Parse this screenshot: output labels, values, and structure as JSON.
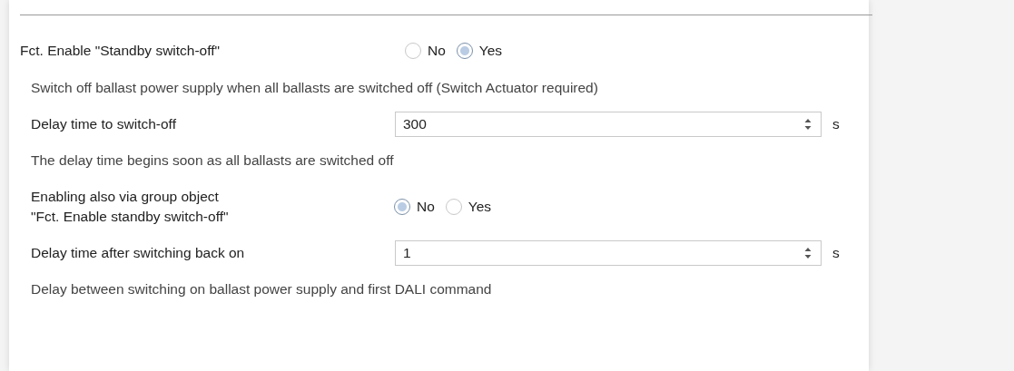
{
  "rows": [
    {
      "kind": "radio",
      "label": "Fct. Enable \"Standby switch-off\"",
      "options": [
        {
          "label": "No",
          "selected": false
        },
        {
          "label": "Yes",
          "selected": true
        }
      ]
    },
    {
      "kind": "note",
      "text": "Switch off ballast power supply when all ballasts are switched off (Switch Actuator required)"
    },
    {
      "kind": "number",
      "label": "Delay time to switch-off",
      "value": "300",
      "unit": "s"
    },
    {
      "kind": "note",
      "text": "The delay time begins soon as all ballasts are switched off"
    },
    {
      "kind": "radio",
      "label": "Enabling also via group object\n\"Fct. Enable standby switch-off\"",
      "options": [
        {
          "label": "No",
          "selected": true
        },
        {
          "label": "Yes",
          "selected": false
        }
      ]
    },
    {
      "kind": "number",
      "label": "Delay time after switching back on",
      "value": "1",
      "unit": "s"
    },
    {
      "kind": "note",
      "text": "Delay between switching on ballast power supply and first DALI command"
    }
  ]
}
